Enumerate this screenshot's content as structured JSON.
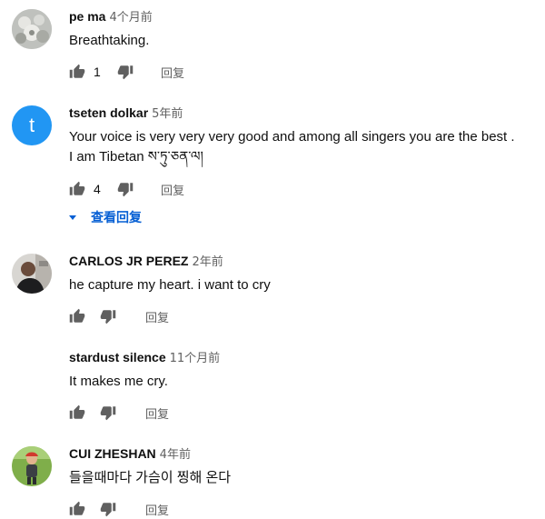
{
  "comments": [
    {
      "author": "pe ma",
      "time": "4个月前",
      "text": [
        "Breathtaking."
      ],
      "likes": "1",
      "reply_label": "回复",
      "avatar_icon": "flower-photo-avatar"
    },
    {
      "author": "tseten dolkar",
      "time": "5年前",
      "text": [
        "Your voice  is very  very very  good  and among all singers  you are the best .",
        "I am Tibetan  ས་ཏུ་ཅན་ལ།"
      ],
      "likes": "4",
      "reply_label": "回复",
      "avatar_letter": "t",
      "avatar_color": "#2196f3"
    },
    {
      "author": "CARLOS JR PEREZ",
      "time": "2年前",
      "text": [
        "he capture my heart. i want to cry"
      ],
      "likes": "",
      "reply_label": "回复",
      "avatar_icon": "man-portrait-avatar"
    },
    {
      "author": "stardust silence",
      "time": "11个月前",
      "text": [
        "It makes me cry."
      ],
      "likes": "",
      "reply_label": "回复"
    },
    {
      "author": "CUI ZHESHAN",
      "time": "4年前",
      "text": [
        "들을때마다 가슴이 찡해 온다"
      ],
      "likes": "",
      "reply_label": "回复",
      "avatar_icon": "child-photo-avatar"
    }
  ],
  "view_replies_label": "查看回复",
  "colors": {
    "author": "#0f0f0f",
    "meta": "#606060",
    "link_blue": "#065fd4",
    "letter_avatar": "#2196f3"
  }
}
